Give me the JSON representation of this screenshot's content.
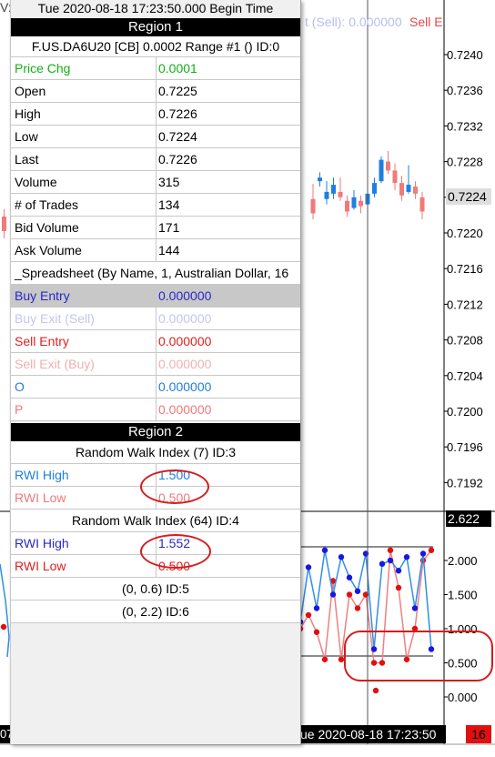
{
  "header": {
    "datetime": "Tue 2020-08-18   17:23:50.000 Begin Time"
  },
  "left_fragment": "V:",
  "top_strip": {
    "buy_exit_text": "t (Sell): 0.000000",
    "sell_entry_text": "Sell E"
  },
  "region1": {
    "title": "Region 1",
    "symbol_line": "F.US.DA6U20 [CB]   0.0002 Range   #1 ()    ID:0",
    "rows": [
      {
        "label": "Price Chg",
        "value": "0.0001",
        "color": "#12b012"
      },
      {
        "label": "Open",
        "value": "0.7225"
      },
      {
        "label": "High",
        "value": "0.7226"
      },
      {
        "label": "Low",
        "value": "0.7224"
      },
      {
        "label": "Last",
        "value": "0.7226"
      },
      {
        "label": "Volume",
        "value": "315"
      },
      {
        "label": "# of Trades",
        "value": "134"
      },
      {
        "label": "Bid Volume",
        "value": "171"
      },
      {
        "label": "Ask Volume",
        "value": "144"
      }
    ],
    "spreadsheet_line": "_Spreadsheet (By Name, 1, Australian Dollar, 16",
    "spreadsheet_rows": [
      {
        "label": "Buy Entry",
        "value": "0.000000",
        "color": "#2828c8"
      },
      {
        "label": "Buy Exit (Sell)",
        "value": "0.000000",
        "color": "#c4c6ee"
      },
      {
        "label": "Sell Entry",
        "value": "0.000000",
        "color": "#e02020"
      },
      {
        "label": "Sell Exit (Buy)",
        "value": "0.000000",
        "color": "#f0b0b0"
      },
      {
        "label": "O",
        "value": "0.000000",
        "color": "#1e7fe0"
      },
      {
        "label": "P",
        "value": "0.000000",
        "color": "#f07a7a"
      }
    ]
  },
  "region2": {
    "title": "Region 2",
    "study1": {
      "title": "Random Walk Index (7)   ID:3",
      "high_label": "RWI High",
      "high_value": "1.500",
      "low_label": "RWI Low",
      "low_value": "0.500"
    },
    "study2": {
      "title": "Random Walk Index (64)   ID:4",
      "high_label": "RWI High",
      "high_value": "1.552",
      "low_label": "RWI Low",
      "low_value": "0.500"
    },
    "line1": "(0, 0.6)   ID:5",
    "line2": "(0, 2.2)   ID:6"
  },
  "price_axis": {
    "labels": [
      "0.7240",
      "0.7236",
      "0.7232",
      "0.7228",
      "0.7224",
      "0.7220",
      "0.7216",
      "0.7212",
      "0.7208",
      "0.7204",
      "0.7200",
      "0.7196",
      "0.7192"
    ],
    "current": "0.7224"
  },
  "rwi_axis": {
    "labels": [
      "2.000",
      "1.500",
      "1.000",
      "0.500",
      "0.000"
    ],
    "current": "2.622"
  },
  "time_axis": {
    "label": "ue 2020-08-18   17:23:50",
    "left_fragment": "07",
    "right_tag": "16"
  },
  "colors": {
    "bull_candle": "#1e7fe0",
    "bear_candle": "#f07a7a",
    "rwi_high_line": "#2f8fe8",
    "rwi_low_line": "#f08080",
    "high_dot": "#1818e0",
    "low_dot": "#e01010",
    "annotation": "#d41c1c"
  },
  "chart_data": {
    "type": "line",
    "price": {
      "ylim": [
        0.719,
        0.7242
      ],
      "candles": [
        {
          "o": 0.72238,
          "h": 0.72255,
          "l": 0.72215,
          "c": 0.72222
        },
        {
          "o": 0.72258,
          "h": 0.72268,
          "l": 0.72252,
          "c": 0.72262
        },
        {
          "o": 0.72238,
          "h": 0.72258,
          "l": 0.72232,
          "c": 0.72246
        },
        {
          "o": 0.72244,
          "h": 0.72262,
          "l": 0.72238,
          "c": 0.72254
        },
        {
          "o": 0.72246,
          "h": 0.72262,
          "l": 0.72236,
          "c": 0.7224
        },
        {
          "o": 0.72236,
          "h": 0.72242,
          "l": 0.72218,
          "c": 0.72224
        },
        {
          "o": 0.72228,
          "h": 0.72248,
          "l": 0.72226,
          "c": 0.7224
        },
        {
          "o": 0.72236,
          "h": 0.72242,
          "l": 0.72222,
          "c": 0.7223
        },
        {
          "o": 0.72232,
          "h": 0.72252,
          "l": 0.72226,
          "c": 0.72244
        },
        {
          "o": 0.72244,
          "h": 0.72262,
          "l": 0.7224,
          "c": 0.72256
        },
        {
          "o": 0.72258,
          "h": 0.72286,
          "l": 0.72256,
          "c": 0.72282
        },
        {
          "o": 0.7228,
          "h": 0.72292,
          "l": 0.72266,
          "c": 0.7227
        },
        {
          "o": 0.7227,
          "h": 0.72278,
          "l": 0.72248,
          "c": 0.72256
        },
        {
          "o": 0.72256,
          "h": 0.72264,
          "l": 0.72236,
          "c": 0.72242
        },
        {
          "o": 0.72246,
          "h": 0.72276,
          "l": 0.72244,
          "c": 0.72254
        },
        {
          "o": 0.72252,
          "h": 0.72258,
          "l": 0.72238,
          "c": 0.72244
        },
        {
          "o": 0.7224,
          "h": 0.72246,
          "l": 0.72215,
          "c": 0.72224
        }
      ]
    },
    "rwi": {
      "ylim": [
        -0.1,
        2.65
      ],
      "levels": [
        0.6,
        2.2
      ],
      "high": [
        1.1,
        1.9,
        1.3,
        2.15,
        1.5,
        2.05,
        1.75,
        1.55,
        2.1,
        0.7,
        1.95,
        2.0,
        1.85,
        2.05,
        1.3,
        2.1,
        0.7
      ],
      "low": [
        1.0,
        1.2,
        0.95,
        0.55,
        1.7,
        0.55,
        1.5,
        1.3,
        1.5,
        0.5,
        0.5,
        2.15,
        1.6,
        0.55,
        1.0,
        2.0,
        2.15
      ]
    },
    "x_label": "ue 2020-08-18   17:23:50"
  }
}
